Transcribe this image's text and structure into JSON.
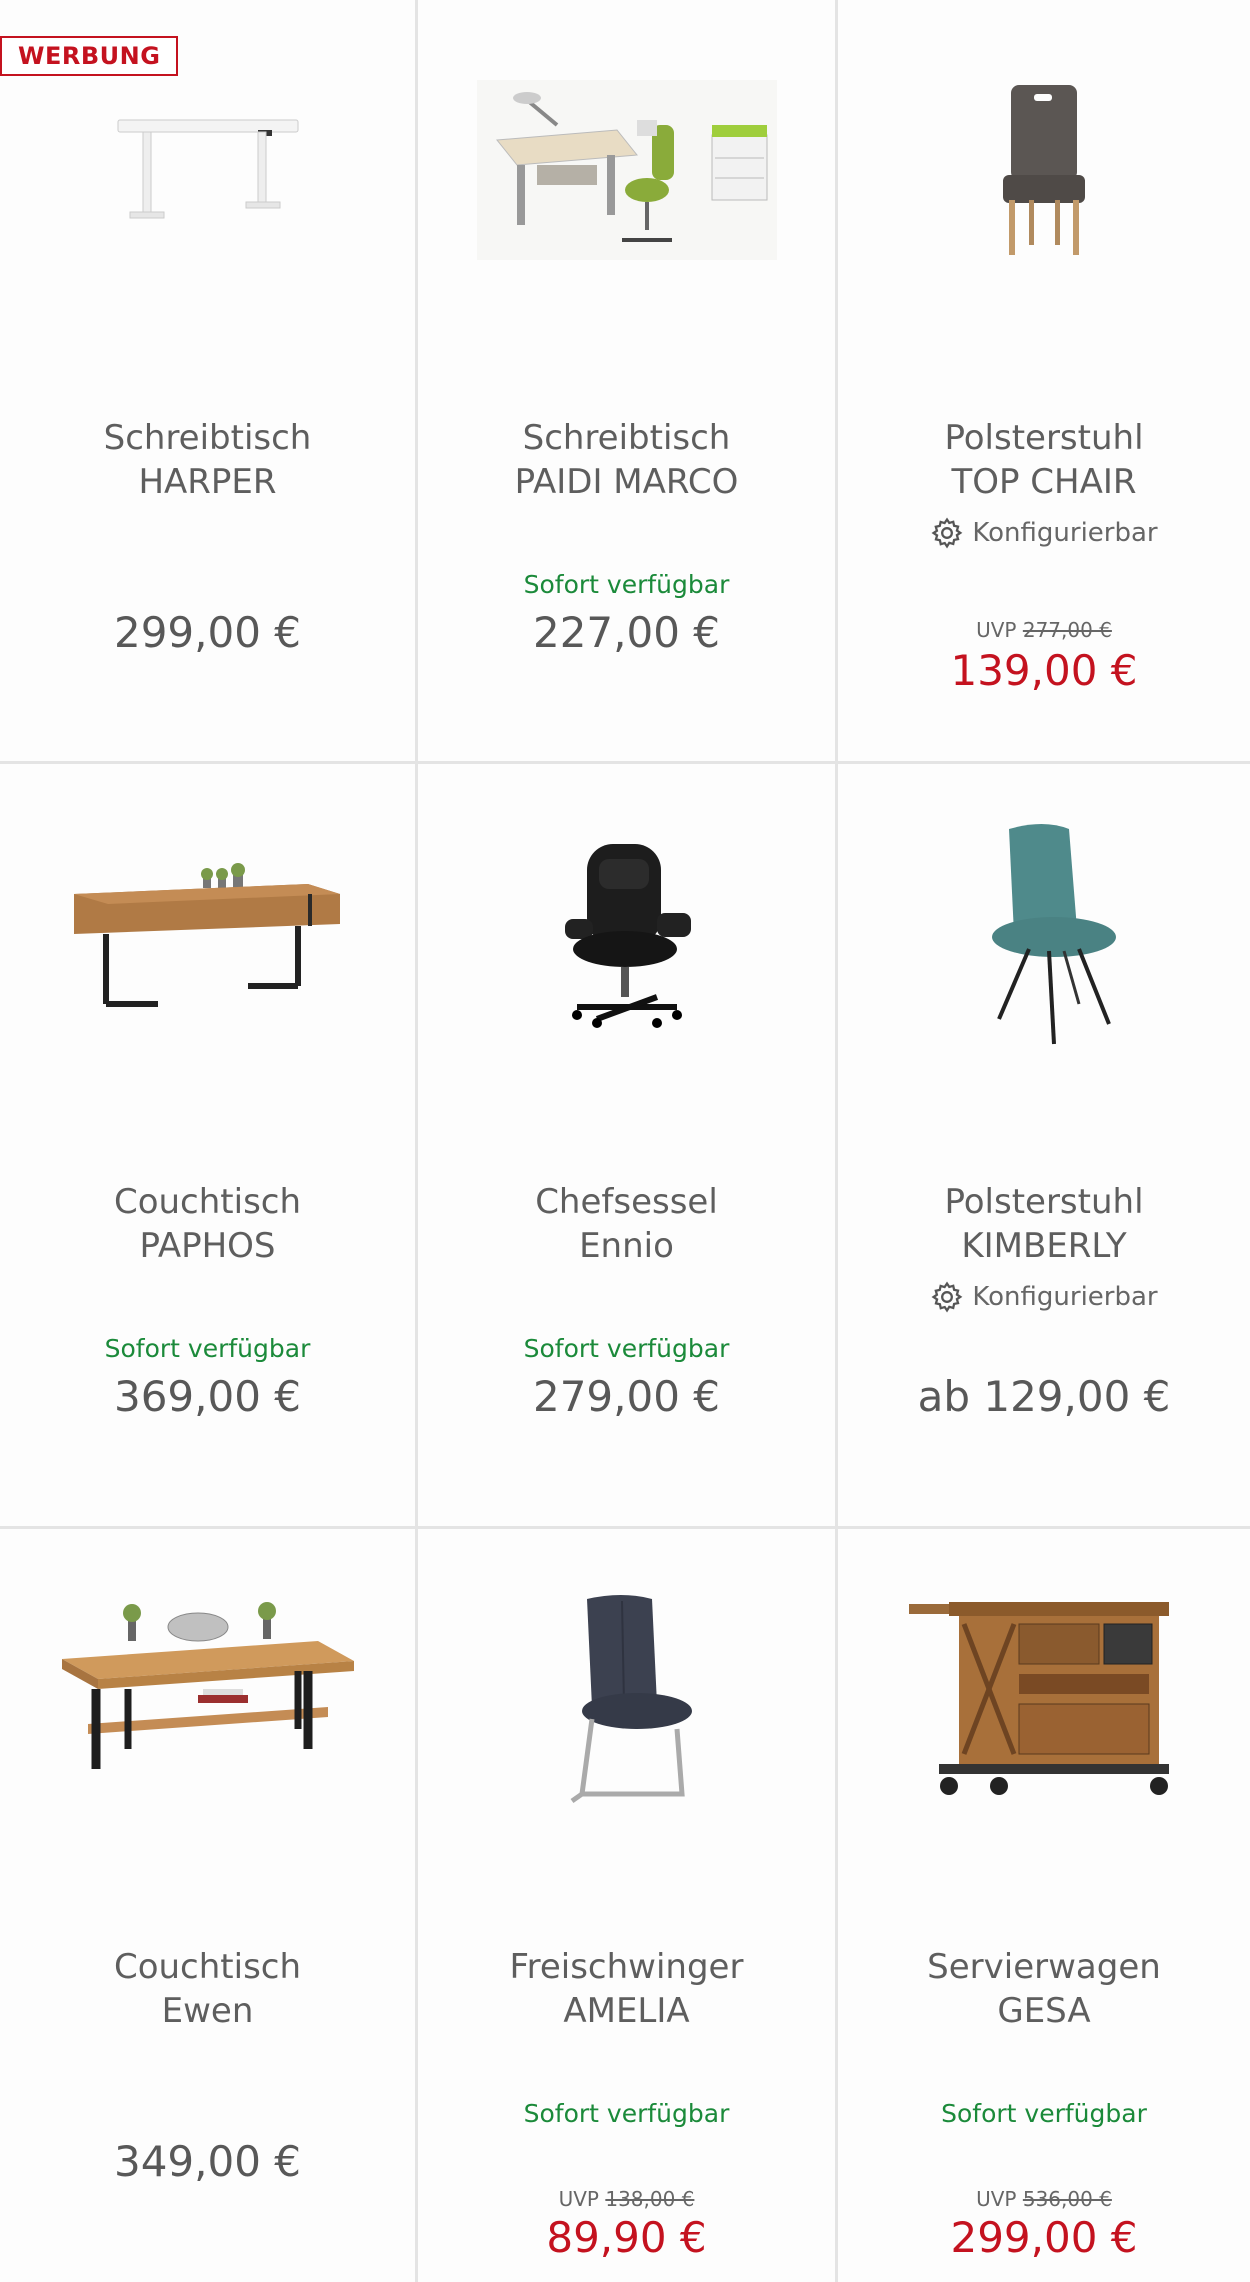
{
  "ad_badge": "WERBUNG",
  "products": [
    {
      "title_line1": "Schreibtisch",
      "title_line2": "HARPER",
      "price": "299,00 €",
      "image": "standing-desk-image"
    },
    {
      "title_line1": "Schreibtisch",
      "title_line2": "PAIDI MARCO",
      "availability": "Sofort verfügbar",
      "price": "227,00 €",
      "image": "kids-desk-set-image"
    },
    {
      "title_line1": "Polsterstuhl",
      "title_line2": "TOP CHAIR",
      "config": "Konfigurierbar",
      "uvp_label": "UVP",
      "uvp_price": "277,00 €",
      "sale_price": "139,00 €",
      "image": "upholstered-chair-image"
    },
    {
      "title_line1": "Couchtisch",
      "title_line2": "PAPHOS",
      "availability": "Sofort verfügbar",
      "price": "369,00 €",
      "image": "coffee-table-image"
    },
    {
      "title_line1": "Chefsessel",
      "title_line2": "Ennio",
      "availability": "Sofort verfügbar",
      "price": "279,00 €",
      "image": "executive-chair-image"
    },
    {
      "title_line1": "Polsterstuhl",
      "title_line2": "KIMBERLY",
      "config": "Konfigurierbar",
      "price": "ab 129,00 €",
      "image": "teal-chair-image"
    },
    {
      "title_line1": "Couchtisch",
      "title_line2": "Ewen",
      "price": "349,00 €",
      "image": "wood-coffee-table-image"
    },
    {
      "title_line1": "Freischwinger",
      "title_line2": "AMELIA",
      "availability": "Sofort verfügbar",
      "uvp_label": "UVP",
      "uvp_price": "138,00 €",
      "sale_price": "89,90 €",
      "image": "cantilever-chair-image"
    },
    {
      "title_line1": "Servierwagen",
      "title_line2": "GESA",
      "availability": "Sofort verfügbar",
      "uvp_label": "UVP",
      "uvp_price": "536,00 €",
      "sale_price": "299,00 €",
      "image": "serving-cart-image"
    }
  ],
  "colors": {
    "sale": "#c4121f",
    "available": "#1b8a3a",
    "text": "#5e5e5e",
    "divider": "#e4e4e4"
  }
}
